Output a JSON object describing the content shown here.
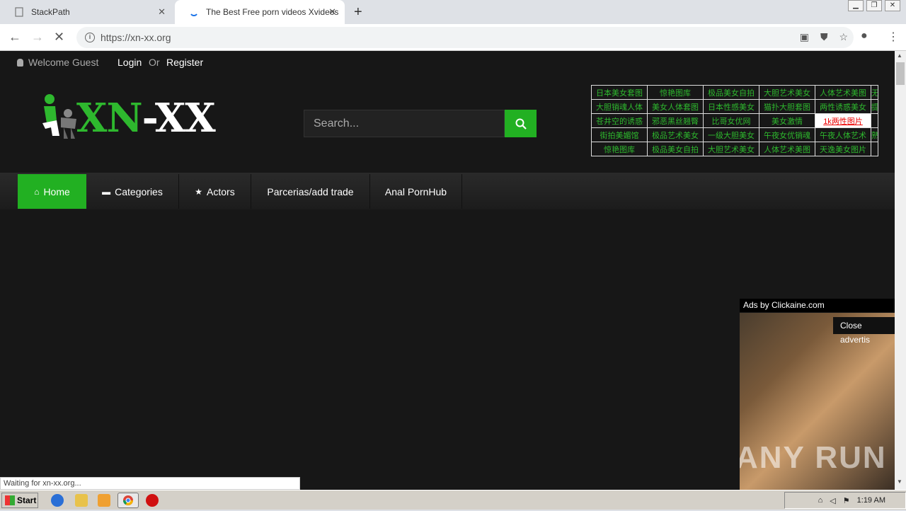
{
  "browser": {
    "tabs": [
      {
        "title": "StackPath",
        "active": false
      },
      {
        "title": "The Best Free porn videos Xvideos",
        "active": true
      }
    ],
    "url": "https://xn-xx.org",
    "status_text": "Waiting for xn-xx.org..."
  },
  "site": {
    "topbar": {
      "welcome": "Welcome Guest",
      "login": "Login",
      "or": "Or",
      "register": "Register"
    },
    "logo": {
      "part1": "XN",
      "dash": "-",
      "part2": "XX"
    },
    "search": {
      "placeholder": "Search..."
    },
    "link_table": [
      [
        "日本美女套图",
        "惊艳图库",
        "极品美女自拍",
        "大胆艺术美女",
        "人体艺术美图",
        "无"
      ],
      [
        "大胆销魂人体",
        "美女人体套图",
        "日本性感美女",
        "猫扑大胆套图",
        "两性诱惑美女",
        "提"
      ],
      [
        "苍井空的诱惑",
        "邪恶黑丝翘臀",
        "比哥女优网",
        "美女激情",
        "1k两性图片",
        ""
      ],
      [
        "街拍美媚馆",
        "极品艺术美女",
        "一级大胆美女",
        "午夜女优销魂",
        "午夜人体艺术",
        "熟"
      ],
      [
        "惊艳图库",
        "极品美女自拍",
        "大胆艺术美女",
        "人体艺术美图",
        "天逸美女图片",
        ""
      ]
    ],
    "menu": [
      {
        "label": "Home",
        "icon": "home-icon"
      },
      {
        "label": "Categories",
        "icon": "folder-icon"
      },
      {
        "label": "Actors",
        "icon": "star-icon"
      },
      {
        "label": "Parcerias/add trade",
        "icon": ""
      },
      {
        "label": "Anal PornHub",
        "icon": ""
      }
    ],
    "ad": {
      "label": "Ads by Clickaine.com",
      "close": "Close advertis",
      "watermark": "ANY RUN"
    }
  },
  "taskbar": {
    "start": "Start",
    "clock": "1:19 AM"
  },
  "colors": {
    "accent": "#22b022",
    "background": "#171717"
  }
}
